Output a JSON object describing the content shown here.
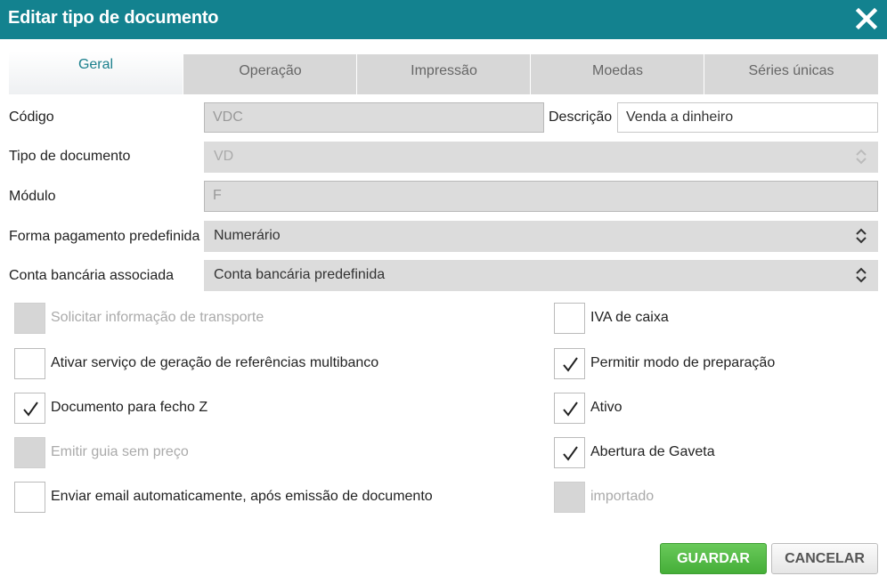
{
  "dialog": {
    "title": "Editar tipo de documento"
  },
  "tabs": [
    {
      "label": "Geral"
    },
    {
      "label": "Operação"
    },
    {
      "label": "Impressão"
    },
    {
      "label": "Moedas"
    },
    {
      "label": "Séries únicas"
    }
  ],
  "form": {
    "codigo": {
      "label": "Código",
      "value": "VDC"
    },
    "descricao": {
      "label": "Descrição",
      "value": "Venda a dinheiro"
    },
    "tipo_documento": {
      "label": "Tipo de documento",
      "value": "VD"
    },
    "modulo": {
      "label": "Módulo",
      "value": "F"
    },
    "forma_pagamento": {
      "label": "Forma pagamento predefinida",
      "value": "Numerário"
    },
    "conta_bancaria": {
      "label": "Conta bancária associada",
      "value": "Conta bancária predefinida"
    }
  },
  "checkboxes_left": [
    {
      "label": "Solicitar informação de transporte",
      "checked": false,
      "disabled": true
    },
    {
      "label": "Ativar serviço de geração de referências multibanco",
      "checked": false,
      "disabled": false
    },
    {
      "label": "Documento para fecho Z",
      "checked": true,
      "disabled": false
    },
    {
      "label": "Emitir guia sem preço",
      "checked": false,
      "disabled": true
    },
    {
      "label": "Enviar email automaticamente, após emissão de documento",
      "checked": false,
      "disabled": false
    }
  ],
  "checkboxes_right": [
    {
      "label": "IVA de caixa",
      "checked": false,
      "disabled": false
    },
    {
      "label": "Permitir modo de preparação",
      "checked": true,
      "disabled": false
    },
    {
      "label": "Ativo",
      "checked": true,
      "disabled": false
    },
    {
      "label": "Abertura de Gaveta",
      "checked": true,
      "disabled": false
    },
    {
      "label": "importado",
      "checked": false,
      "disabled": true
    }
  ],
  "buttons": {
    "save": "GUARDAR",
    "cancel": "CANCELAR"
  },
  "colors": {
    "header": "#13828f",
    "save": "#4cb53f",
    "active_tab_text": "#1a7f8c"
  }
}
